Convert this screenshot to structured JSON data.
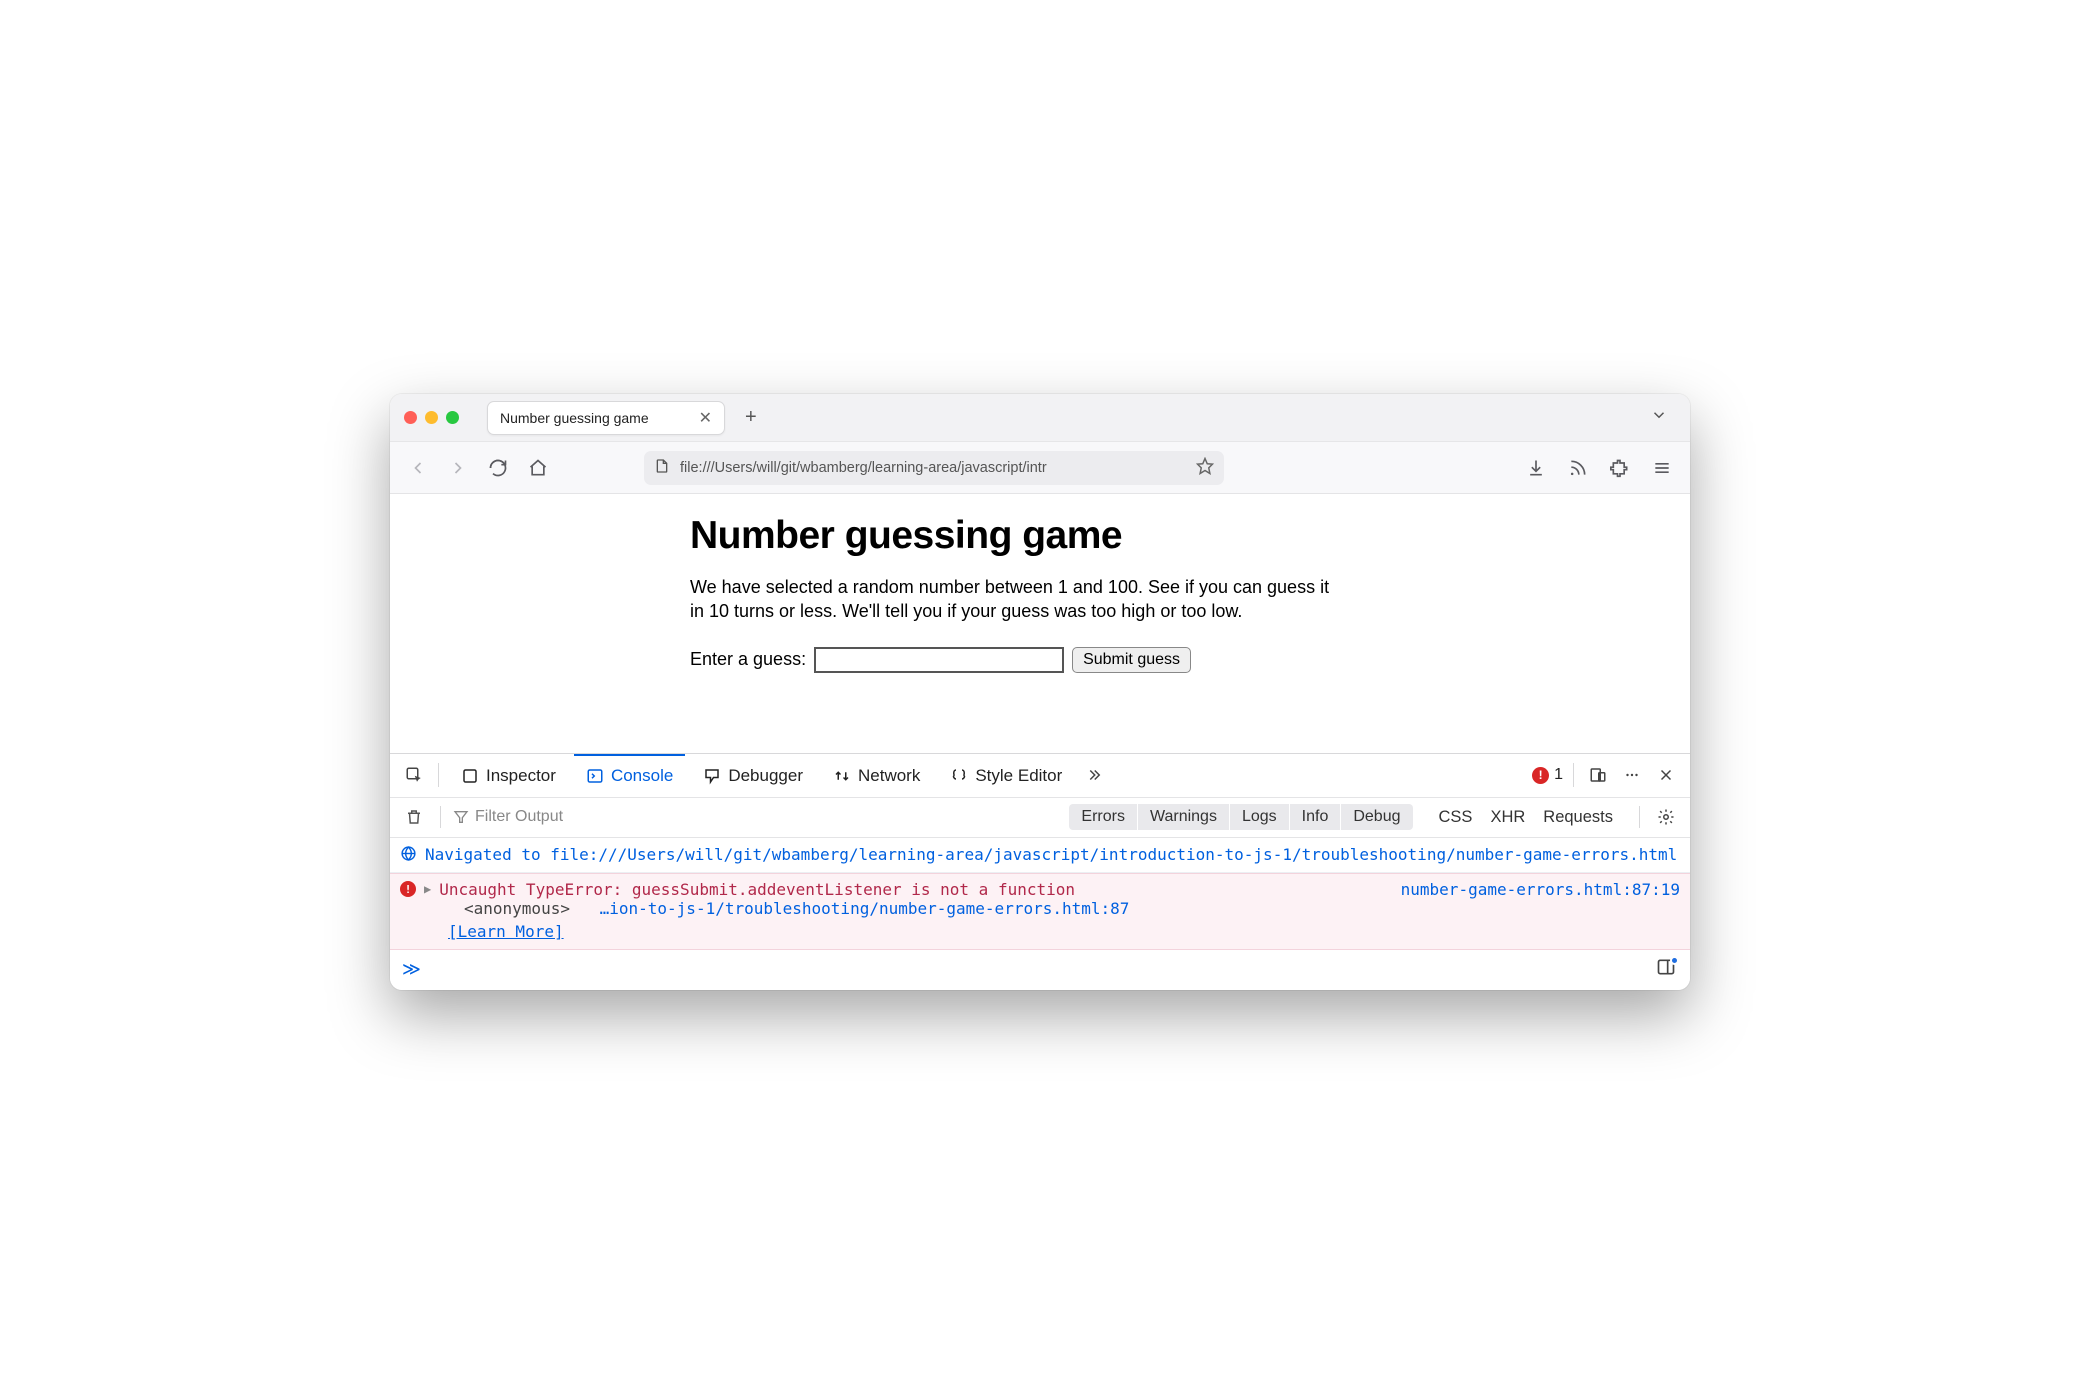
{
  "window": {
    "tab_title": "Number guessing game",
    "tabs_overflow_icon": "chevron-down"
  },
  "toolbar": {
    "url": "file:///Users/will/git/wbamberg/learning-area/javascript/intr"
  },
  "page": {
    "heading": "Number guessing game",
    "instructions": "We have selected a random number between 1 and 100. See if you can guess it in 10 turns or less. We'll tell you if your guess was too high or too low.",
    "guess_label": "Enter a guess:",
    "guess_value": "",
    "submit_label": "Submit guess"
  },
  "devtools": {
    "tabs": {
      "inspector": "Inspector",
      "console": "Console",
      "debugger": "Debugger",
      "network": "Network",
      "style_editor": "Style Editor"
    },
    "error_count": "1",
    "filter_placeholder": "Filter Output",
    "levels": {
      "errors": "Errors",
      "warnings": "Warnings",
      "logs": "Logs",
      "info": "Info",
      "debug": "Debug"
    },
    "extra_filters": {
      "css": "CSS",
      "xhr": "XHR",
      "requests": "Requests"
    },
    "log_nav": "Navigated to file:///Users/will/git/wbamberg/learning-area/javascript/introduction-to-js-1/troubleshooting/number-game-errors.html",
    "error": {
      "message": "Uncaught TypeError: guessSubmit.addeventListener is not a function",
      "location": "number-game-errors.html:87:19",
      "stack_anon": "<anonymous>",
      "stack_path": "…ion-to-js-1/troubleshooting/number-game-errors.html:87",
      "learn_more": "[Learn More]"
    },
    "prompt": "≫"
  }
}
